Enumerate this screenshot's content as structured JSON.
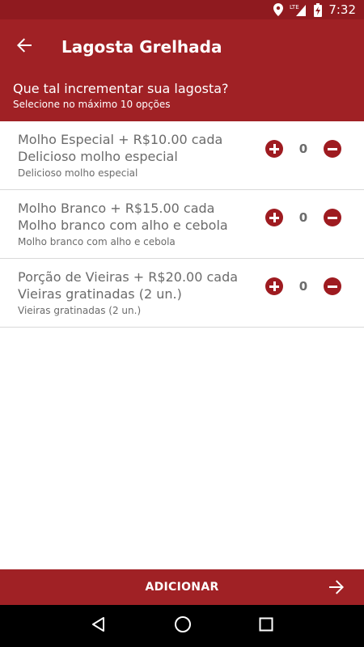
{
  "status_bar": {
    "time": "7:32",
    "network_label": "LTE",
    "icons": [
      "location-icon",
      "signal-icon",
      "battery-charging-icon"
    ]
  },
  "app_bar": {
    "title": "Lagosta Grelhada",
    "back_icon": "arrow-back-icon"
  },
  "header": {
    "title": "Que tal incrementar sua lagosta?",
    "subtitle": "Selecione no máximo 10 opções"
  },
  "options": [
    {
      "title_line": "Molho Especial + R$10.00 cada",
      "subtitle_line": "Delicioso molho especial",
      "description": "Delicioso molho especial",
      "quantity": "0"
    },
    {
      "title_line": "Molho Branco + R$15.00 cada",
      "subtitle_line": "Molho branco com alho e cebola",
      "description": "Molho branco com alho e cebola",
      "quantity": "0"
    },
    {
      "title_line": "Porção de Vieiras + R$20.00 cada",
      "subtitle_line": "Vieiras gratinadas (2 un.)",
      "description": "Vieiras gratinadas (2 un.)",
      "quantity": "0"
    }
  ],
  "footer": {
    "add_label": "ADICIONAR",
    "arrow_icon": "arrow-forward-icon"
  },
  "nav_bar": {
    "icons": [
      "back-triangle-icon",
      "home-circle-icon",
      "recents-square-icon"
    ]
  },
  "colors": {
    "primary": "#a02125",
    "status_bar": "#8f1a1f",
    "button": "#9e1b20",
    "text_secondary": "#6b6b6b"
  }
}
